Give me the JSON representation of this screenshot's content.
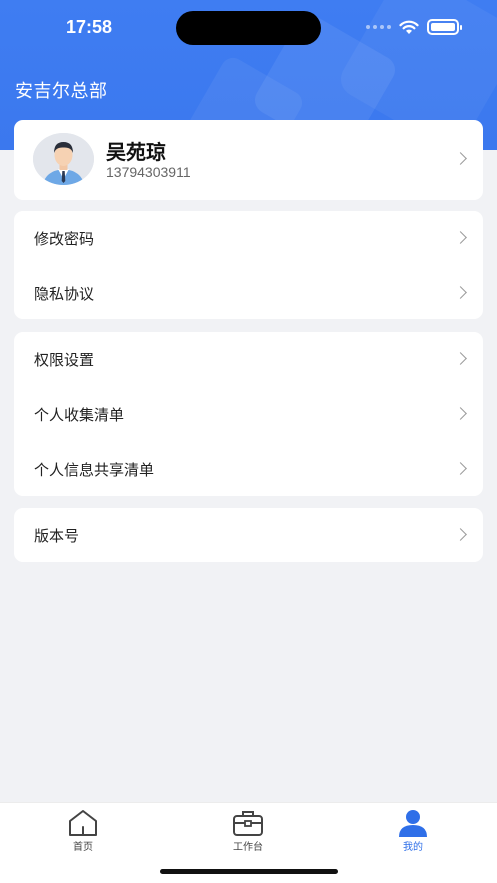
{
  "status_bar": {
    "time": "17:58"
  },
  "header": {
    "org_name": "安吉尔总部"
  },
  "profile": {
    "name": "吴苑琼",
    "phone": "13794303911"
  },
  "menu_groups": [
    {
      "items": [
        {
          "label": "修改密码"
        },
        {
          "label": "隐私协议"
        }
      ]
    },
    {
      "items": [
        {
          "label": "权限设置"
        },
        {
          "label": "个人收集清单"
        },
        {
          "label": "个人信息共享清单"
        }
      ]
    },
    {
      "items": [
        {
          "label": "版本号"
        }
      ]
    }
  ],
  "tabbar": {
    "tabs": [
      {
        "label": "首页",
        "icon": "home-icon",
        "active": false
      },
      {
        "label": "工作台",
        "icon": "briefcase-icon",
        "active": false
      },
      {
        "label": "我的",
        "icon": "person-icon",
        "active": true
      }
    ]
  },
  "colors": {
    "primary": "#3b78ee",
    "active_tab": "#2f6fe8",
    "background": "#f1f2f5"
  }
}
